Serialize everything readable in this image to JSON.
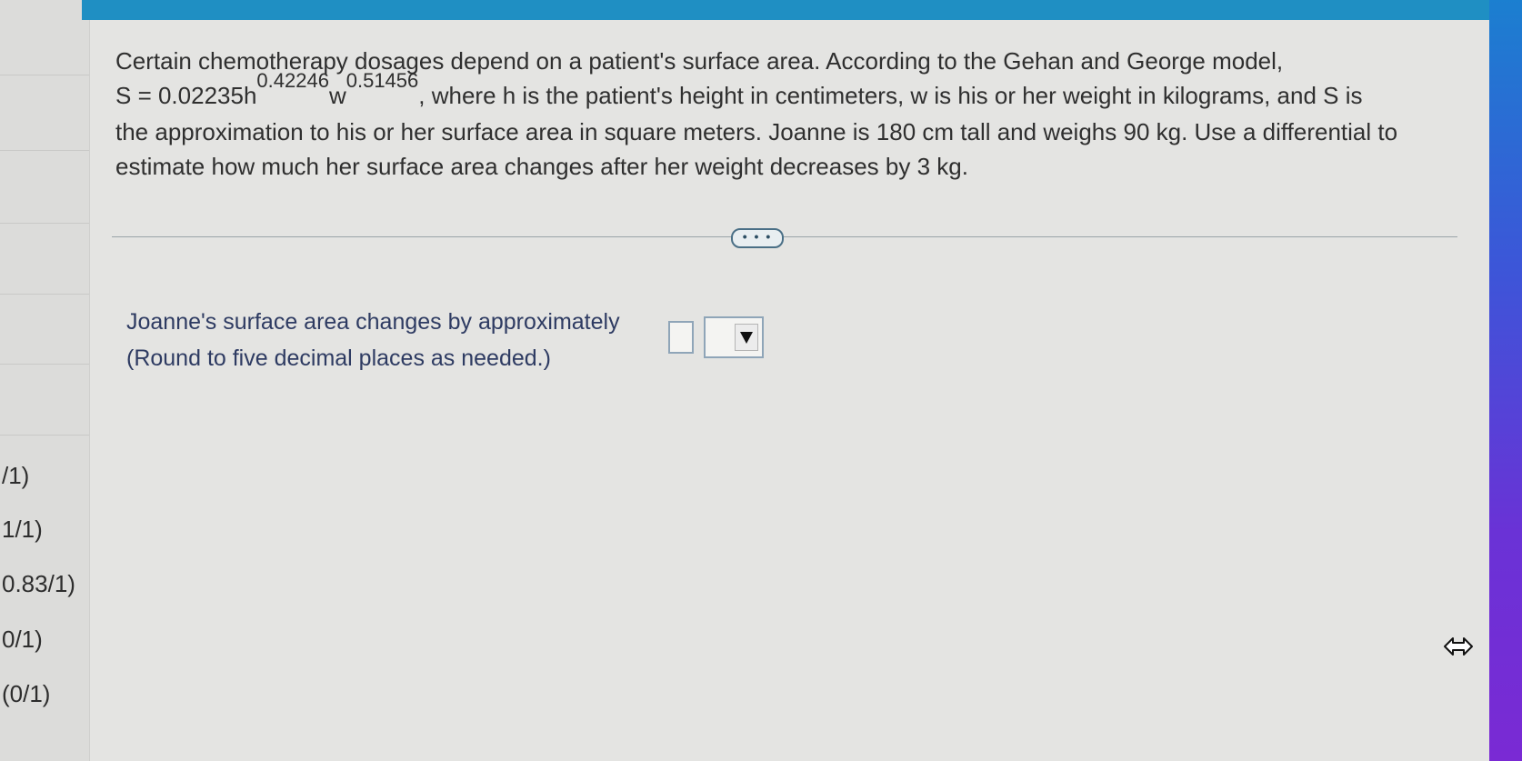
{
  "sidebar": {
    "scores": [
      "/1)",
      "1/1)",
      "0.83/1)",
      "0/1)",
      "(0/1)"
    ]
  },
  "question": {
    "line1": "Certain chemotherapy dosages depend on a patient's surface area. According to the Gehan and George model,",
    "formula_base": "S = 0.02235h",
    "exp_h": "0.42246",
    "formula_w": "w",
    "exp_w": "0.51456",
    "line2_rest": ", where h is the patient's height in centimeters, w is his or her weight in kilograms, and S is",
    "line3": "the approximation to his or her surface area in square meters. Joanne is 180 cm tall and weighs 90 kg. Use a differential to",
    "line4": "estimate how much her surface area changes after her weight decreases by 3 kg."
  },
  "more_button": {
    "label": "• • •"
  },
  "answer": {
    "prompt": "Joanne's surface area changes by approximately",
    "hint": "(Round to five decimal places as needed.)",
    "input_value": "",
    "select_value": ""
  },
  "colors": {
    "topbar": "#1f8fc3",
    "panel": "#e4e4e2",
    "answer_text": "#2e3b62"
  }
}
